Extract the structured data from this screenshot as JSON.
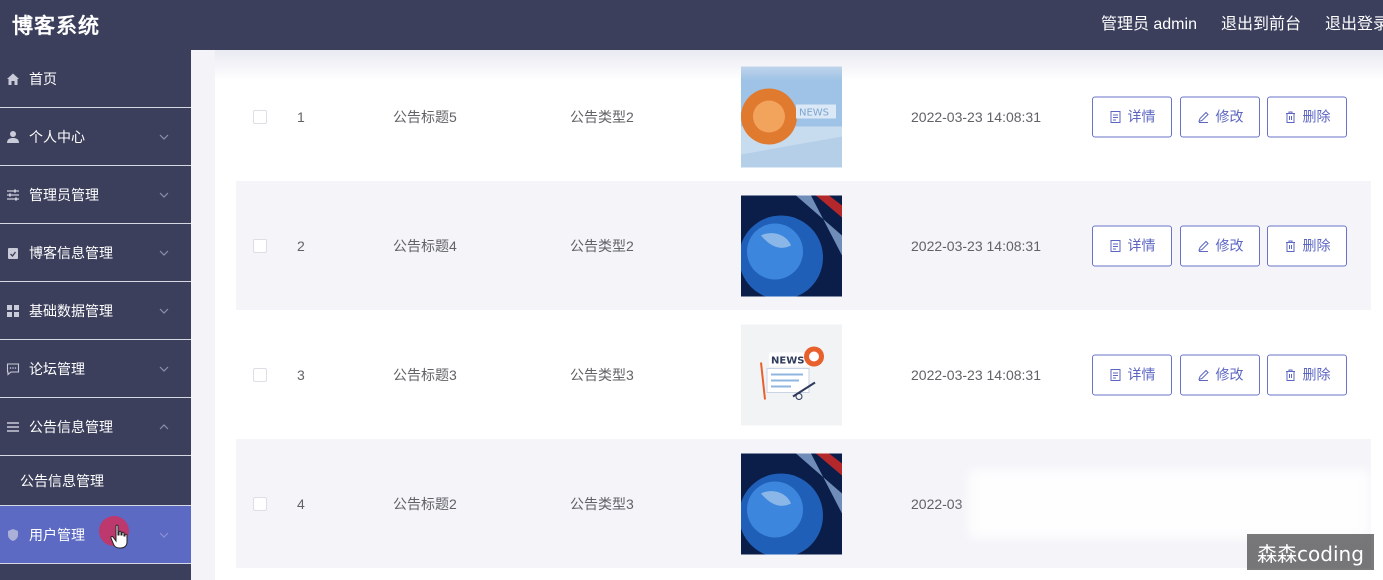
{
  "header": {
    "brand": "博客系统",
    "admin_label": "管理员 admin",
    "to_frontend": "退出到前台",
    "logout": "退出登录"
  },
  "sidebar": {
    "items": [
      {
        "label": "首页",
        "icon": "home-icon"
      },
      {
        "label": "个人中心",
        "icon": "user-icon"
      },
      {
        "label": "管理员管理",
        "icon": "sliders-icon"
      },
      {
        "label": "博客信息管理",
        "icon": "clipboard-icon"
      },
      {
        "label": "基础数据管理",
        "icon": "grid-icon"
      },
      {
        "label": "论坛管理",
        "icon": "chat-icon"
      },
      {
        "label": "公告信息管理",
        "icon": "list-icon"
      }
    ],
    "sub_item": "公告信息管理",
    "active_item": {
      "label": "用户管理",
      "icon": "shield-icon"
    }
  },
  "table": {
    "rows": [
      {
        "index": "1",
        "title": "公告标题5",
        "type": "公告类型2",
        "image": "news-orange",
        "time": "2022-03-23 14:08:31"
      },
      {
        "index": "2",
        "title": "公告标题4",
        "type": "公告类型2",
        "image": "globe-blue",
        "time": "2022-03-23 14:08:31"
      },
      {
        "index": "3",
        "title": "公告标题3",
        "type": "公告类型3",
        "image": "news-illustration",
        "time": "2022-03-23 14:08:31"
      },
      {
        "index": "4",
        "title": "公告标题2",
        "type": "公告类型3",
        "image": "globe-blue",
        "time": "2022-03"
      }
    ],
    "actions": {
      "detail": "详情",
      "edit": "修改",
      "delete": "删除"
    }
  },
  "watermark": "森森coding",
  "colors": {
    "header_bg": "#3b3f5c",
    "active_menu": "#5c6ac4",
    "button_border": "#6a73c9"
  }
}
